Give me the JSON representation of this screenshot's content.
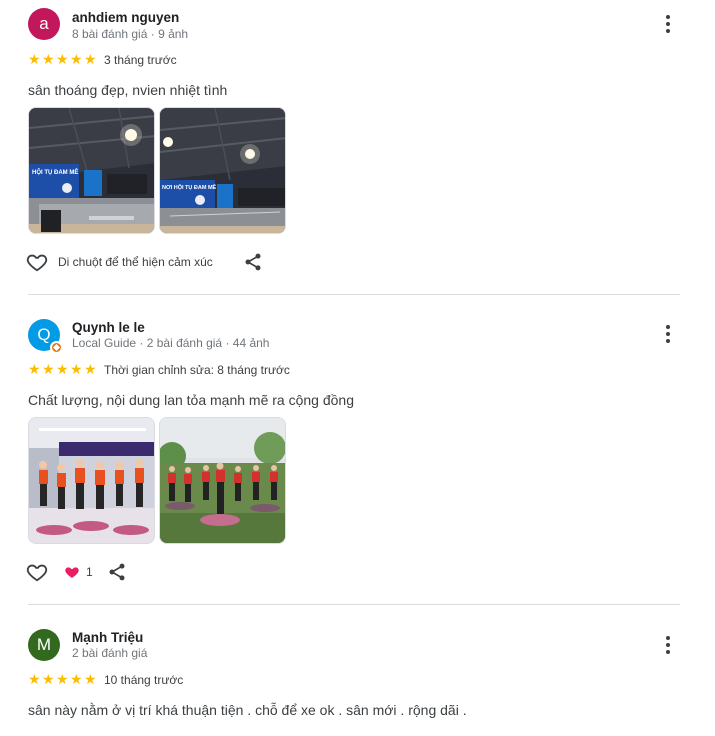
{
  "reviews": [
    {
      "avatar_letter": "a",
      "avatar_color": "#c2185b",
      "name": "anhdiem nguyen",
      "meta": "8 bài đánh giá · 9 ảnh",
      "rating": 5,
      "when": "3 tháng trước",
      "text": "sân thoáng đẹp, nvien nhiệt tình",
      "reaction_hint": "Di chuột để thể hiện cảm xúc"
    },
    {
      "avatar_letter": "Q",
      "avatar_color": "#039be5",
      "local_guide": true,
      "name": "Quynh le le",
      "meta": "Local Guide · 2 bài đánh giá · 44 ảnh",
      "rating": 5,
      "when": "Thời gian chỉnh sửa: 8 tháng trước",
      "text": "Chất lượng, nội dung lan tỏa mạnh mẽ ra cộng đồng",
      "reaction_count": "1"
    },
    {
      "avatar_letter": "M",
      "avatar_color": "#33691e",
      "name": "Mạnh Triệu",
      "meta": "2 bài đánh giá",
      "rating": 5,
      "when": "10 tháng trước",
      "text": "sân này nằm ở vị trí khá thuận tiện . chỗ để xe ok . sân mới . rộng dãi ."
    }
  ],
  "photo_banner_1": "HỘI TỤ ĐAM MÊ",
  "photo_banner_2": "NƠI HỘI TỤ ĐAM MÊ",
  "icons": {
    "more": "more-vert-icon",
    "like": "heart-outline-icon",
    "share": "share-icon",
    "reaction": "heart-filled-icon",
    "star": "star-icon"
  },
  "colors": {
    "star": "#fbbc04",
    "reaction": "#e91e63"
  }
}
